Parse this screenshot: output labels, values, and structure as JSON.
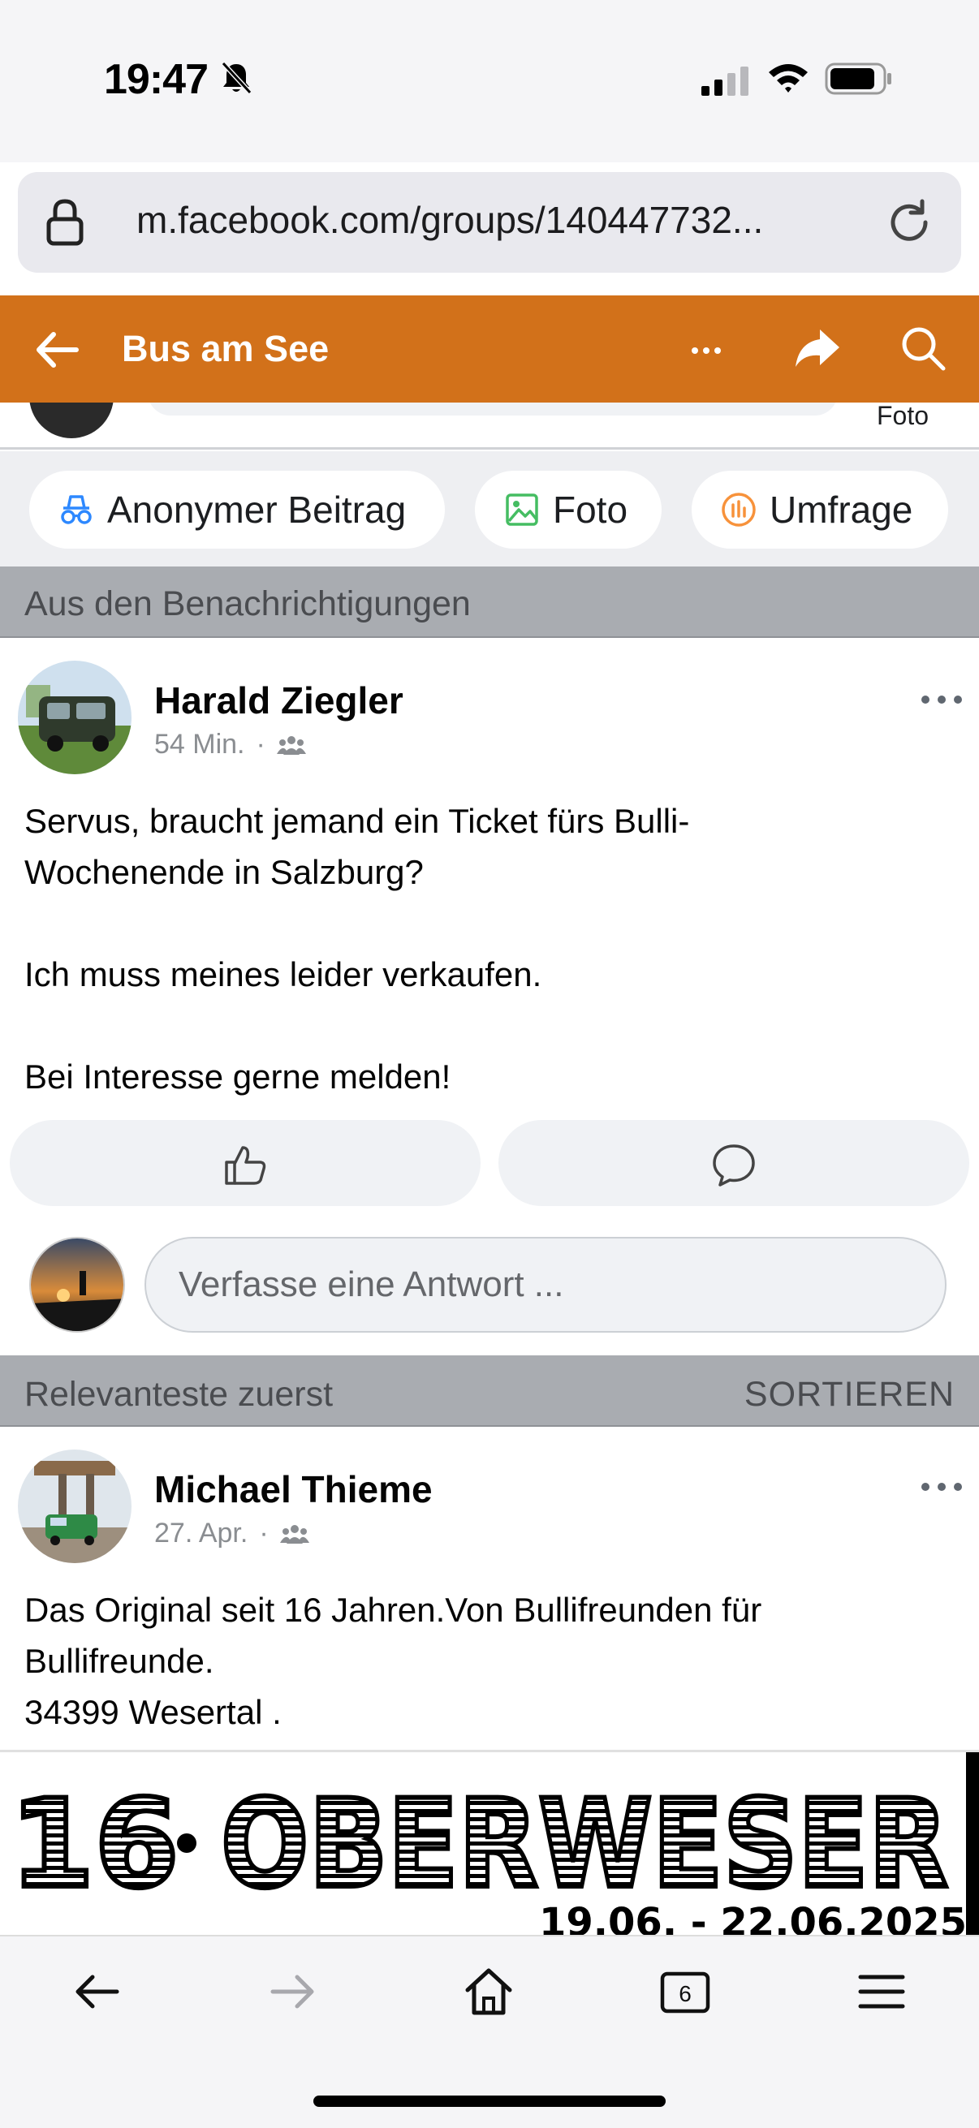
{
  "status_bar": {
    "time": "19:47",
    "icons": [
      "bell-off-icon",
      "cellular-signal-icon",
      "wifi-icon",
      "battery-icon"
    ]
  },
  "browser": {
    "url": "m.facebook.com/groups/140447732..."
  },
  "group_header": {
    "title": "Bus am See",
    "color": "#d2711a",
    "icons": [
      "back-arrow-icon",
      "more-icon",
      "share-icon",
      "search-icon"
    ]
  },
  "peek_row": {
    "foto_label": "Foto"
  },
  "composer": {
    "chips": [
      {
        "label": "Anonymer Beitrag",
        "icon": "incognito-icon"
      },
      {
        "label": "Foto",
        "icon": "photo-icon"
      },
      {
        "label": "Umfrage",
        "icon": "poll-icon"
      }
    ]
  },
  "sections": {
    "notifications_label": "Aus den Benachrichtigungen",
    "relevance_label": "Relevanteste zuerst",
    "sort_label": "SORTIEREN"
  },
  "posts": [
    {
      "author": "Harald Ziegler",
      "time": "54 Min.",
      "audience_icon": "group-icon",
      "text": [
        "Servus, braucht jemand ein Ticket fürs Bulli-",
        "Wochenende in Salzburg?",
        "",
        "Ich muss meines leider verkaufen.",
        "",
        "Bei Interesse gerne melden!"
      ]
    },
    {
      "author": "Michael Thieme",
      "time": "27. Apr.",
      "audience_icon": "group-icon",
      "text": [
        "Das Original seit 16 Jahren.Von Bullifreunden für",
        "Bullifreunde.",
        "34399 Wesertal ."
      ]
    }
  ],
  "actions": {
    "like_icon": "thumbs-up-icon",
    "comment_icon": "comment-icon"
  },
  "reply": {
    "placeholder": "Verfasse eine Antwort ..."
  },
  "banner": {
    "number": "16",
    "title": "OBERWESER",
    "dates": "19.06. - 22.06.2025"
  },
  "bottom_nav": {
    "tab_count": "6",
    "icons": [
      "back-icon",
      "forward-icon",
      "home-icon",
      "tabs-icon",
      "menu-icon"
    ]
  }
}
